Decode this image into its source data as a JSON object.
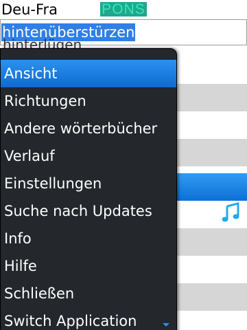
{
  "header": {
    "dictionary": "Deu-Fra",
    "logo_text": "PONS"
  },
  "search": {
    "value": "hintenüberstürzen"
  },
  "results": {
    "partial_text": "hinterlügen"
  },
  "menu": {
    "items": [
      {
        "label": "Ansicht",
        "selected": true
      },
      {
        "label": "Richtungen"
      },
      {
        "label": "Andere wörterbücher"
      },
      {
        "label": "Verlauf"
      },
      {
        "label": "Einstellungen"
      },
      {
        "label": "Suche nach Updates"
      },
      {
        "label": "Info"
      },
      {
        "label": "Hilfe"
      },
      {
        "label": "Schließen"
      },
      {
        "label": "Switch Application"
      }
    ]
  },
  "icons": {
    "audio": "music-note-icon",
    "more": "scroll-down-arrow-icon"
  },
  "colors": {
    "accent": "#2f7fe6",
    "logo_bg": "#1fa78f",
    "menu_bg": "#24272b",
    "row_alt": "#d6d6d6"
  }
}
